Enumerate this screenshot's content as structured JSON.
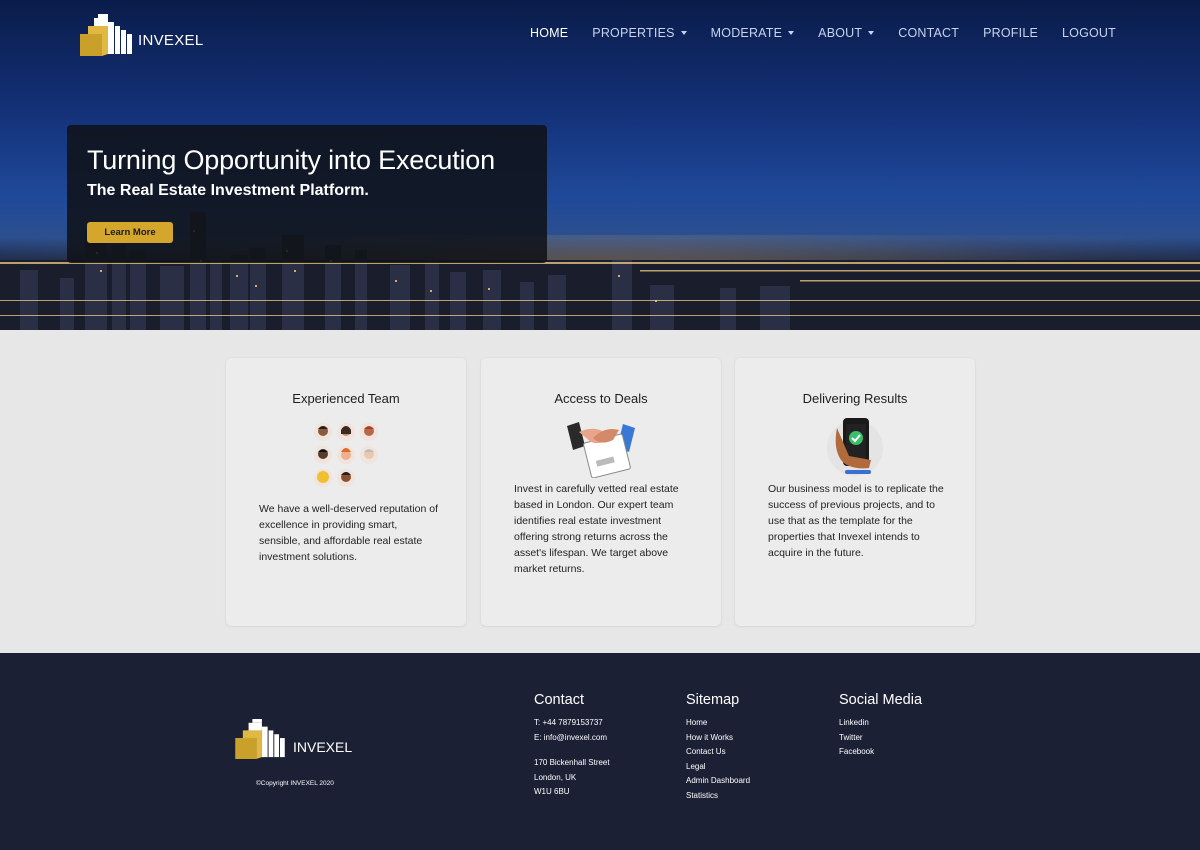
{
  "nav": {
    "brand": "INVEXEL",
    "items": [
      {
        "label": "HOME",
        "active": true,
        "dropdown": false
      },
      {
        "label": "PROPERTIES",
        "active": false,
        "dropdown": true
      },
      {
        "label": "MODERATE",
        "active": false,
        "dropdown": true
      },
      {
        "label": "ABOUT",
        "active": false,
        "dropdown": true
      },
      {
        "label": "CONTACT",
        "active": false,
        "dropdown": false
      },
      {
        "label": "PROFILE",
        "active": false,
        "dropdown": false
      },
      {
        "label": "LOGOUT",
        "active": false,
        "dropdown": false
      }
    ]
  },
  "hero": {
    "title": "Turning Opportunity into Execution",
    "subtitle": "The Real Estate Investment Platform.",
    "button_label": "Learn More"
  },
  "features": [
    {
      "title": "Experienced Team",
      "icon": "team-avatars-icon",
      "text": "We have a well-deserved reputation of excellence in providing smart, sensible, and affordable real estate investment solutions."
    },
    {
      "title": "Access to Deals",
      "icon": "handshake-icon",
      "text": "Invest in carefully vetted real estate based in London. Our expert team identifies real estate investment offering strong returns across the asset's lifespan. We target above market returns."
    },
    {
      "title": "Delivering Results",
      "icon": "phone-check-icon",
      "text": "Our business model is to replicate the success of previous projects, and to use that as the template for the properties that Invexel intends to acquire in the future."
    }
  ],
  "footer": {
    "brand": "INVEXEL",
    "copyright": "©Copyright INVEXEL 2020",
    "contact": {
      "heading": "Contact",
      "phone": "T: +44 7879153737",
      "email": "E: info@invexel.com",
      "address": [
        "170 Bickenhall Street",
        "London, UK",
        "W1U 6BU"
      ]
    },
    "sitemap": {
      "heading": "Sitemap",
      "links": [
        "Home",
        "How it Works",
        "Contact Us",
        "Legal",
        "Admin Dashboard",
        "Statistics"
      ]
    },
    "social": {
      "heading": "Social Media",
      "links": [
        "Linkedin",
        "Twitter",
        "Facebook"
      ]
    }
  },
  "colors": {
    "accent_gold": "#d4a72c",
    "footer_bg": "#1b2034",
    "hero_card_bg": "#0f1116"
  }
}
